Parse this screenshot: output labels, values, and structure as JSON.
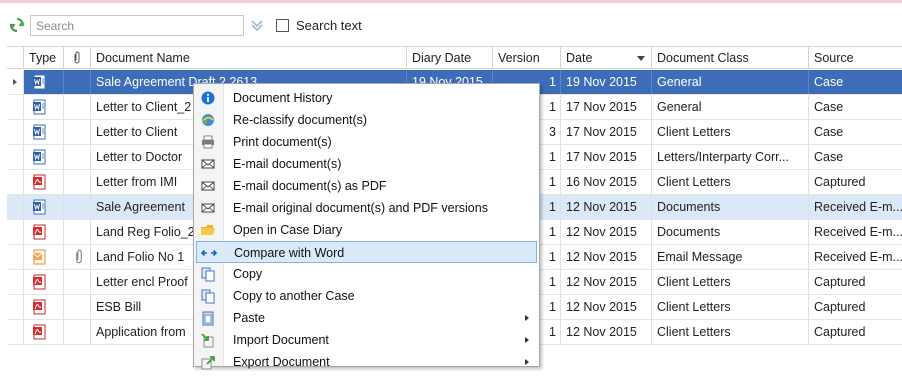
{
  "toolbar": {
    "search_placeholder": "Search",
    "search_text_label": "Search text",
    "search_text_checked": false
  },
  "columns": [
    {
      "key": "type",
      "label": "Type"
    },
    {
      "key": "attach",
      "label": ""
    },
    {
      "key": "name",
      "label": "Document Name"
    },
    {
      "key": "diary",
      "label": "Diary Date"
    },
    {
      "key": "version",
      "label": "Version"
    },
    {
      "key": "date",
      "label": "Date"
    },
    {
      "key": "class",
      "label": "Document Class"
    },
    {
      "key": "source",
      "label": "Source"
    }
  ],
  "rows": [
    {
      "icon": "word-doc-icon",
      "attach": false,
      "name": "Sale Agreement Draft 2 2613",
      "diary": "19 Nov 2015",
      "version": "1",
      "date": "19 Nov 2015",
      "class": "General",
      "source": "Case",
      "state": "selected"
    },
    {
      "icon": "word-doc-icon",
      "attach": false,
      "name": "Letter to Client_2",
      "diary": "",
      "version": "1",
      "date": "17 Nov 2015",
      "class": "General",
      "source": "Case",
      "state": ""
    },
    {
      "icon": "word-doc-icon",
      "attach": false,
      "name": "Letter to Client",
      "diary": "",
      "version": "3",
      "date": "17 Nov 2015",
      "class": "Client Letters",
      "source": "Case",
      "state": ""
    },
    {
      "icon": "word-doc-icon",
      "attach": false,
      "name": "Letter to Doctor",
      "diary": "",
      "version": "1",
      "date": "17 Nov 2015",
      "class": "Letters/Interparty Corr...",
      "source": "Case",
      "state": ""
    },
    {
      "icon": "pdf-doc-icon",
      "attach": false,
      "name": "Letter from IMI",
      "diary": "",
      "version": "1",
      "date": "16 Nov 2015",
      "class": "Client Letters",
      "source": "Captured",
      "state": ""
    },
    {
      "icon": "word-doc-icon",
      "attach": false,
      "name": "Sale Agreement",
      "diary": "",
      "version": "1",
      "date": "12 Nov 2015",
      "class": "Documents",
      "source": "Received E-m...",
      "state": "highlight"
    },
    {
      "icon": "pdf-doc-icon",
      "attach": false,
      "name": "Land Reg Folio_2",
      "diary": "",
      "version": "1",
      "date": "12 Nov 2015",
      "class": "Documents",
      "source": "Received E-m...",
      "state": ""
    },
    {
      "icon": "email-doc-icon",
      "attach": true,
      "name": "Land Folio No 1",
      "diary": "",
      "version": "1",
      "date": "12 Nov 2015",
      "class": "Email Message",
      "source": "Received E-m...",
      "state": ""
    },
    {
      "icon": "pdf-doc-icon",
      "attach": false,
      "name": "Letter encl Proof",
      "diary": "",
      "version": "1",
      "date": "12 Nov 2015",
      "class": "Client Letters",
      "source": "Captured",
      "state": ""
    },
    {
      "icon": "pdf-doc-icon",
      "attach": false,
      "name": "ESB Bill",
      "diary": "",
      "version": "1",
      "date": "12 Nov 2015",
      "class": "Client Letters",
      "source": "Captured",
      "state": ""
    },
    {
      "icon": "pdf-doc-icon",
      "attach": false,
      "name": "Application from",
      "diary": "",
      "version": "1",
      "date": "12 Nov 2015",
      "class": "Client Letters",
      "source": "Captured",
      "state": ""
    }
  ],
  "context_menu": {
    "items": [
      {
        "label": "Document History",
        "icon": "info-icon",
        "submenu": false,
        "hover": false
      },
      {
        "label": "Re-classify document(s)",
        "icon": "reclassify-icon",
        "submenu": false,
        "hover": false
      },
      {
        "label": "Print document(s)",
        "icon": "printer-icon",
        "submenu": false,
        "hover": false
      },
      {
        "label": "E-mail document(s)",
        "icon": "envelope-icon",
        "submenu": false,
        "hover": false
      },
      {
        "label": "E-mail document(s) as PDF",
        "icon": "envelope-icon",
        "submenu": false,
        "hover": false
      },
      {
        "label": "E-mail original document(s) and PDF versions",
        "icon": "envelope-icon",
        "submenu": false,
        "hover": false
      },
      {
        "label": "Open in Case Diary",
        "icon": "folder-icon",
        "submenu": false,
        "hover": false
      },
      {
        "label": "Compare with Word",
        "icon": "compare-icon",
        "submenu": false,
        "hover": true
      },
      {
        "label": "Copy",
        "icon": "copy-icon",
        "submenu": false,
        "hover": false
      },
      {
        "label": "Copy to another Case",
        "icon": "copy-icon",
        "submenu": false,
        "hover": false
      },
      {
        "label": "Paste",
        "icon": "paste-icon",
        "submenu": true,
        "hover": false
      },
      {
        "label": "Import Document",
        "icon": "import-icon",
        "submenu": true,
        "hover": false
      },
      {
        "label": "Export Document",
        "icon": "export-icon",
        "submenu": true,
        "hover": false
      }
    ]
  },
  "colors": {
    "selected_row": "#3d6db8",
    "highlight_row": "#dbe8f8",
    "menu_hover": "#dbeaf9",
    "menu_hover_border": "#7eb4ea",
    "top_accent": "#f4c9dd"
  }
}
